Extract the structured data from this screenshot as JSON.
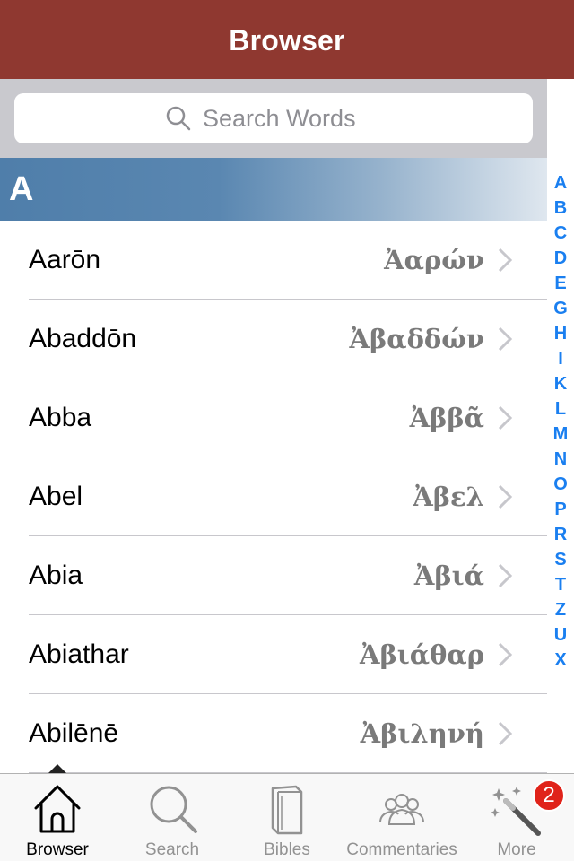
{
  "navbar": {
    "title": "Browser"
  },
  "search": {
    "placeholder": "Search Words",
    "icon": "search-icon"
  },
  "section": {
    "letter": "A"
  },
  "rows": [
    {
      "english": "Aarōn",
      "greek": "Ἀαρών"
    },
    {
      "english": "Abaddōn",
      "greek": "Ἀβαδδών"
    },
    {
      "english": "Abba",
      "greek": "Ἀββᾶ"
    },
    {
      "english": "Abel",
      "greek": "Ἀβελ"
    },
    {
      "english": "Abia",
      "greek": "Ἀβιά"
    },
    {
      "english": "Abiathar",
      "greek": "Ἀβιάθαρ"
    },
    {
      "english": "Abilēnē",
      "greek": "Ἀβιληνή"
    }
  ],
  "index_letters": [
    "A",
    "B",
    "C",
    "D",
    "E",
    "G",
    "H",
    "I",
    "K",
    "L",
    "M",
    "N",
    "O",
    "P",
    "R",
    "S",
    "T",
    "Z",
    "U",
    "X"
  ],
  "tabs": [
    {
      "label": "Browser",
      "icon": "home-icon",
      "active": true
    },
    {
      "label": "Search",
      "icon": "magnifier-icon",
      "active": false
    },
    {
      "label": "Bibles",
      "icon": "books-icon",
      "active": false
    },
    {
      "label": "Commentaries",
      "icon": "people-icon",
      "active": false
    },
    {
      "label": "More",
      "icon": "magic-wand-icon",
      "active": false,
      "badge": "2"
    }
  ],
  "colors": {
    "navbar": "#8f3830",
    "index": "#1a7ff0",
    "badge": "#e0231a"
  }
}
